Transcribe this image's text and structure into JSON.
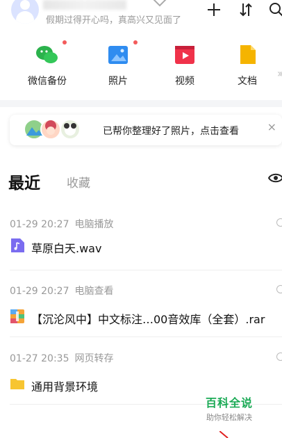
{
  "header": {
    "subtitle": "假期过得开心吗，真高兴又见面了",
    "icons": [
      "avatar",
      "vip-diamond-icon",
      "add-icon",
      "sort-icon",
      "search-icon"
    ]
  },
  "quick_access": [
    {
      "label": "微信备份",
      "icon": "wechat-backup-icon",
      "badge": true
    },
    {
      "label": "照片",
      "icon": "photo-icon",
      "badge": true
    },
    {
      "label": "视频",
      "icon": "video-icon",
      "badge": false
    },
    {
      "label": "文档",
      "icon": "document-icon",
      "badge": false
    }
  ],
  "banner": {
    "text": "已帮你整理好了照片，点击查看",
    "close": "×"
  },
  "tabs": {
    "recent": "最近",
    "favorites": "收藏"
  },
  "recent_groups": [
    {
      "time": "01-29 20:27",
      "source": "电脑播放",
      "file": "草原白天.wav",
      "file_icon": "audio-file-icon"
    },
    {
      "time": "01-29 20:27",
      "source": "电脑查看",
      "file": "【沉沦风中】中文标注…00音效库（全套）.rar",
      "file_icon": "archive-file-icon"
    },
    {
      "time": "01-27 20:35",
      "source": "网页转存",
      "file": "通用背景环境",
      "file_icon": "folder-icon"
    }
  ],
  "watermark": {
    "title": "百科全说",
    "subtitle": "助你轻松解决"
  },
  "colors": {
    "badge": "#f35b5b",
    "wechat": "#2bb24c",
    "photo": "#2f8cf0",
    "video": "#f0324a",
    "document": "#f5b400",
    "folder": "#f7c531",
    "audio": "#7a6cf0",
    "watermark": "#1aaa55"
  }
}
